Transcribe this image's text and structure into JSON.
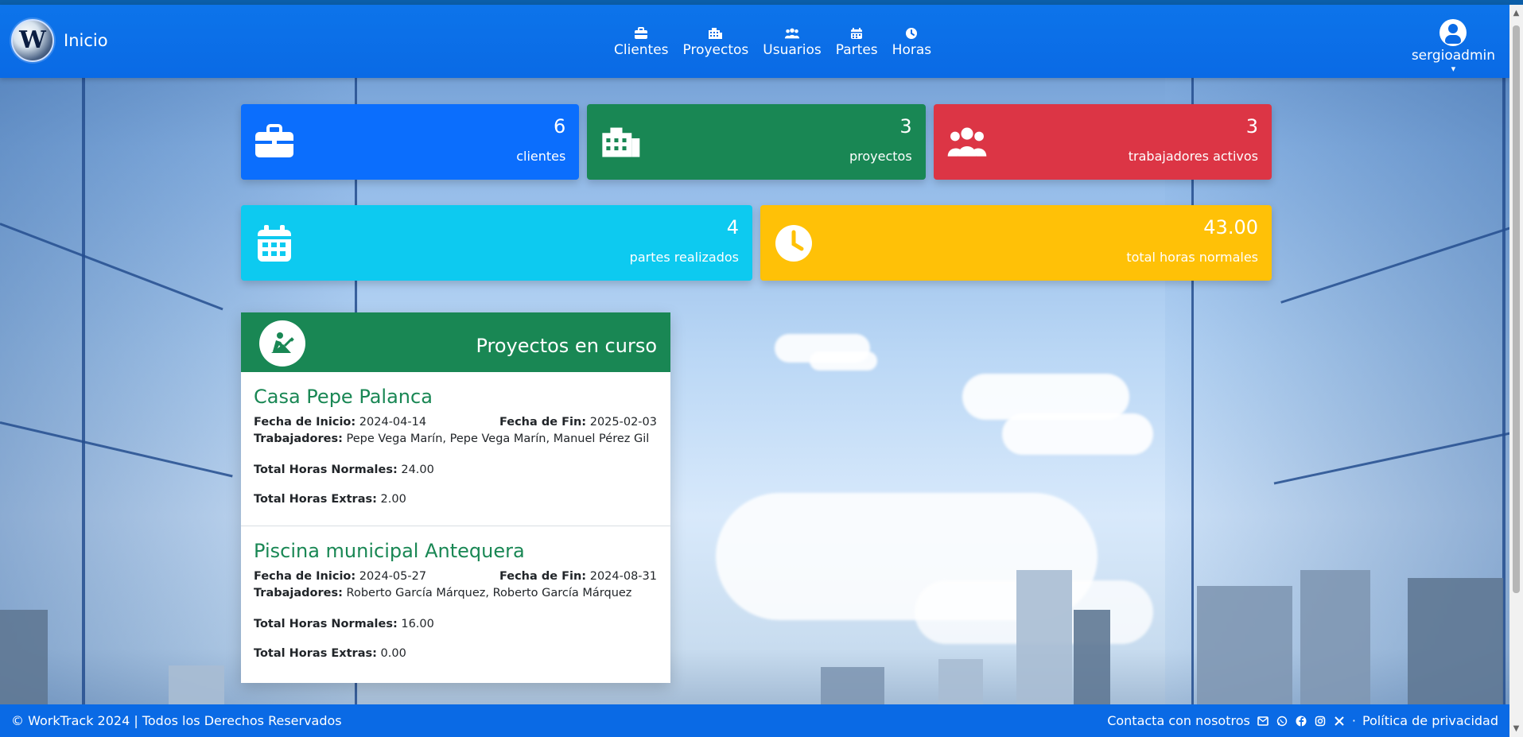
{
  "header": {
    "brand_title": "Inicio",
    "logo_letter": "W",
    "nav": [
      {
        "label": "Clientes",
        "icon": "briefcase-icon"
      },
      {
        "label": "Proyectos",
        "icon": "building-icon"
      },
      {
        "label": "Usuarios",
        "icon": "users-icon"
      },
      {
        "label": "Partes",
        "icon": "calendar-icon"
      },
      {
        "label": "Horas",
        "icon": "clock-icon"
      }
    ],
    "user": {
      "name": "sergioadmin",
      "caret": "▾",
      "icon": "user-circle-icon"
    }
  },
  "stats": [
    {
      "value": "6",
      "label": "clientes",
      "color": "#0b6efd",
      "icon": "briefcase-icon"
    },
    {
      "value": "3",
      "label": "proyectos",
      "color": "#198754",
      "icon": "building-icon"
    },
    {
      "value": "3",
      "label": "trabajadores activos",
      "color": "#dc3545",
      "icon": "users-icon"
    },
    {
      "value": "4",
      "label": "partes realizados",
      "color": "#0dcaf0",
      "icon": "calendar-icon"
    },
    {
      "value": "43.00",
      "label": "total horas normales",
      "color": "#ffc107",
      "icon": "clock-icon"
    }
  ],
  "projects_panel": {
    "title": "Proyectos en curso",
    "icon": "person-digging-icon",
    "projects": [
      {
        "name": "Casa Pepe Palanca",
        "start_label": "Fecha de Inicio:",
        "start": "2024-04-14",
        "end_label": "Fecha de Fin:",
        "end": "2025-02-03",
        "workers_label": "Trabajadores:",
        "workers": "Pepe Vega Marín, Pepe Vega Marín, Manuel Pérez Gil",
        "normal_label": "Total Horas Normales:",
        "normal": "24.00",
        "extra_label": "Total Horas Extras:",
        "extra": "2.00"
      },
      {
        "name": "Piscina municipal Antequera",
        "start_label": "Fecha de Inicio:",
        "start": "2024-05-27",
        "end_label": "Fecha de Fin:",
        "end": "2024-08-31",
        "workers_label": "Trabajadores:",
        "workers": "Roberto García Márquez, Roberto García Márquez",
        "normal_label": "Total Horas Normales:",
        "normal": "16.00",
        "extra_label": "Total Horas Extras:",
        "extra": "0.00"
      }
    ]
  },
  "footer": {
    "left": "© WorkTrack 2024 | Todos los Derechos Reservados",
    "contact": "Contacta con nosotros",
    "social_icons": [
      "mail-icon",
      "whatsapp-icon",
      "facebook-icon",
      "instagram-icon",
      "x-icon"
    ],
    "privacy_prefix": "·",
    "privacy": "Política de privacidad"
  },
  "scroll": {
    "up": "▲",
    "down": "▼"
  }
}
